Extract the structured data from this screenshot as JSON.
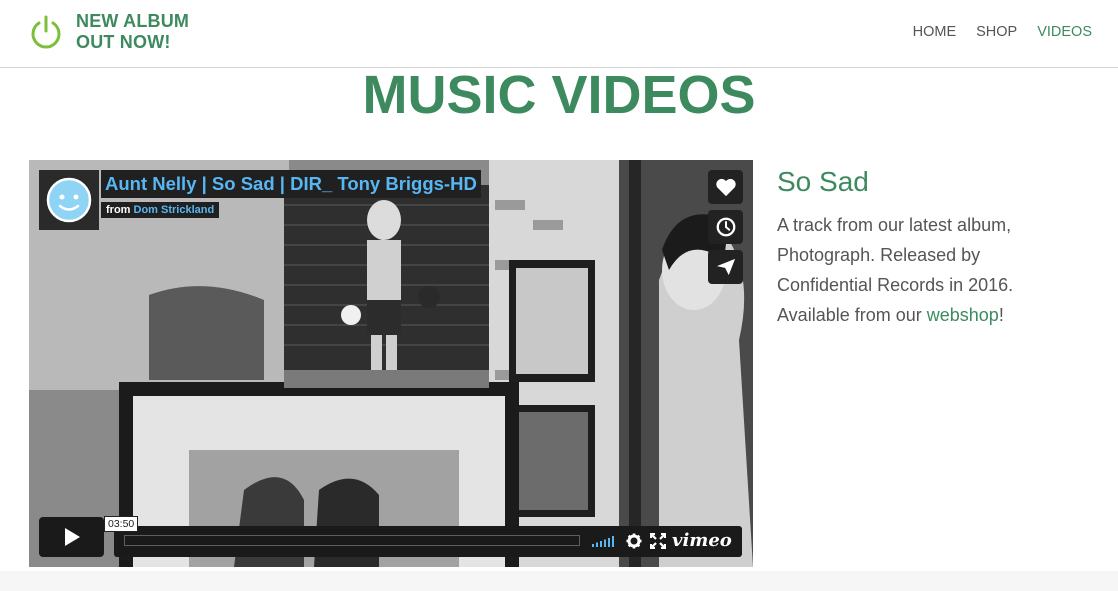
{
  "site": {
    "brand_line1": "NEW ALBUM",
    "brand_line2": "OUT NOW!",
    "logo_icon": "power-icon",
    "accent": "#3d8a5f"
  },
  "nav": {
    "items": [
      {
        "label": "HOME",
        "active": false
      },
      {
        "label": "SHOP",
        "active": false
      },
      {
        "label": "VIDEOS",
        "active": true
      }
    ]
  },
  "page": {
    "title": "MUSIC VIDEOS"
  },
  "video": {
    "title": "Aunt Nelly | So Sad | DIR_ Tony Briggs-HD",
    "byline_prefix": "from",
    "author": "Dom Strickland",
    "timecode": "03:50",
    "brand": "vimeo",
    "icons": [
      "heart-icon",
      "clock-icon",
      "send-icon",
      "play-icon",
      "volume-icon",
      "settings-icon",
      "fullscreen-icon"
    ]
  },
  "song": {
    "title": "So Sad",
    "desc_before": "A track from our latest album, Photograph. Released by Confidential Records in 2016. Available from our ",
    "link_text": "webshop",
    "desc_after": "!"
  }
}
